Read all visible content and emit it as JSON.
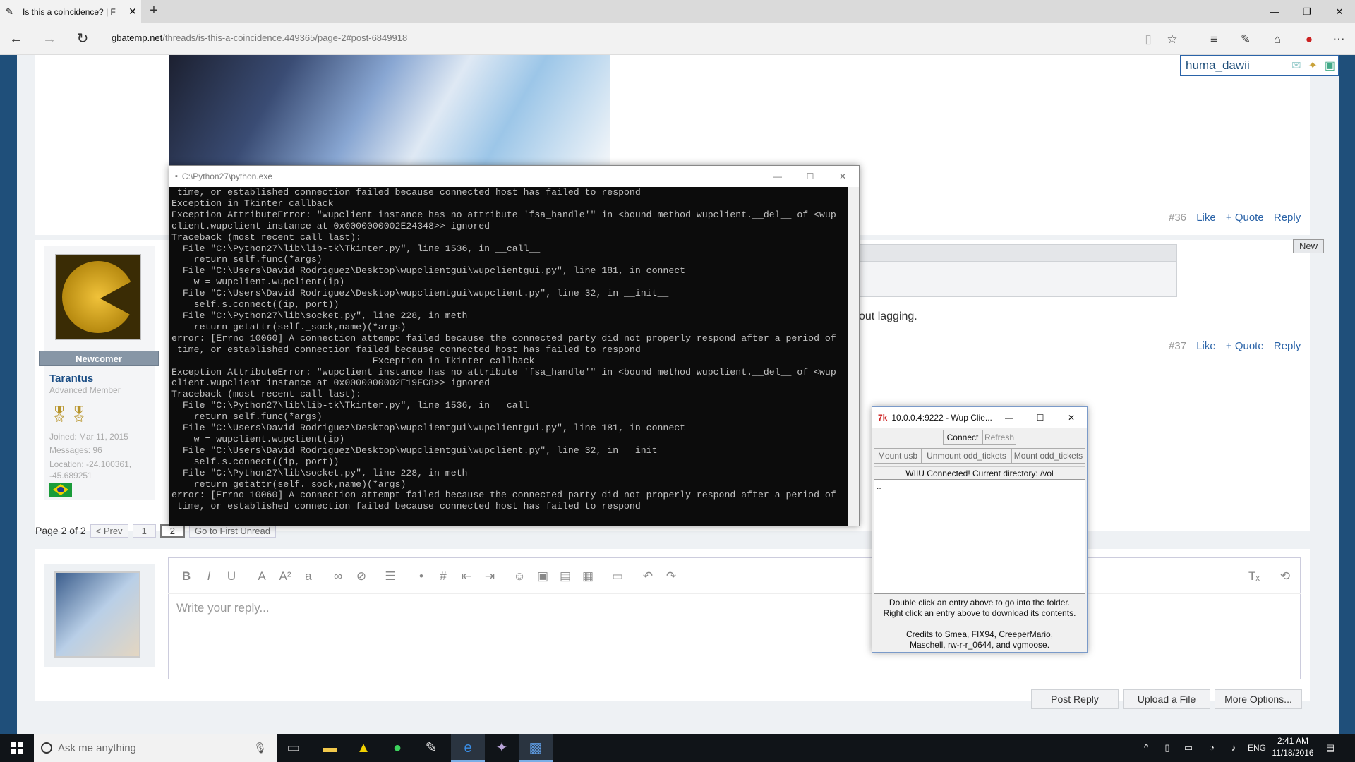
{
  "browser": {
    "tab_title": "Is this a coincidence? | F",
    "new_tab": "+",
    "url_domain": "gbatemp.net",
    "url_path": "/threads/is-this-a-coincidence.449365/page-2#post-6849918"
  },
  "header_user": {
    "name": "huma_dawii"
  },
  "posts": [
    {
      "number": "#36",
      "like": "Like",
      "quote": "+ Quote",
      "reply": "Reply"
    },
    {
      "number": "#37",
      "like": "Like",
      "quote": "+ Quote",
      "reply": "Reply",
      "text_fragment": "out lagging.",
      "new_badge": "New"
    }
  ],
  "author": {
    "rank": "Newcomer",
    "name": "Tarantus",
    "title": "Advanced Member",
    "joined": "Joined: Mar 11, 2015",
    "messages": "Messages: 96",
    "location1": "Location: -24.100361,",
    "location2": "-45.689251"
  },
  "pagination": {
    "label": "Page 2 of 2",
    "prev": "< Prev",
    "page1": "1",
    "page2": "2",
    "first_unread": "Go to First Unread"
  },
  "reply": {
    "placeholder": "Write your reply...",
    "post_reply": "Post Reply",
    "upload": "Upload a File",
    "more": "More Options..."
  },
  "console": {
    "title": "C:\\Python27\\python.exe",
    "output": " time, or established connection failed because connected host has failed to respond\nException in Tkinter callback\nException AttributeError: \"wupclient instance has no attribute 'fsa_handle'\" in <bound method wupclient.__del__ of <wup\nclient.wupclient instance at 0x0000000002E24348>> ignored\nTraceback (most recent call last):\n  File \"C:\\Python27\\lib\\lib-tk\\Tkinter.py\", line 1536, in __call__\n    return self.func(*args)\n  File \"C:\\Users\\David Rodriguez\\Desktop\\wupclientgui\\wupclientgui.py\", line 181, in connect\n    w = wupclient.wupclient(ip)\n  File \"C:\\Users\\David Rodriguez\\Desktop\\wupclientgui\\wupclient.py\", line 32, in __init__\n    self.s.connect((ip, port))\n  File \"C:\\Python27\\lib\\socket.py\", line 228, in meth\n    return getattr(self._sock,name)(*args)\nerror: [Errno 10060] A connection attempt failed because the connected party did not properly respond after a period of\n time, or established connection failed because connected host has failed to respond\n                                    Exception in Tkinter callback\nException AttributeError: \"wupclient instance has no attribute 'fsa_handle'\" in <bound method wupclient.__del__ of <wup\nclient.wupclient instance at 0x0000000002E19FC8>> ignored\nTraceback (most recent call last):\n  File \"C:\\Python27\\lib\\lib-tk\\Tkinter.py\", line 1536, in __call__\n    return self.func(*args)\n  File \"C:\\Users\\David Rodriguez\\Desktop\\wupclientgui\\wupclientgui.py\", line 181, in connect\n    w = wupclient.wupclient(ip)\n  File \"C:\\Users\\David Rodriguez\\Desktop\\wupclientgui\\wupclient.py\", line 32, in __init__\n    self.s.connect((ip, port))\n  File \"C:\\Python27\\lib\\socket.py\", line 228, in meth\n    return getattr(self._sock,name)(*args)\nerror: [Errno 10060] A connection attempt failed because the connected party did not properly respond after a period of\n time, or established connection failed because connected host has failed to respond"
  },
  "wup": {
    "title": "10.0.0.4:9222 - Wup Clie...",
    "connect": "Connect",
    "refresh": "Refresh",
    "mount_usb": "Mount usb",
    "unmount_odd": "Unmount odd_tickets",
    "mount_odd": "Mount odd_tickets",
    "status": "WIIU Connected! Current directory: /vol",
    "list_item": "..",
    "help1": "Double click an entry above to go into the folder.",
    "help2": "Right click an entry above to download its contents.",
    "credits1": "Credits to Smea, FIX94, CreeperMario,",
    "credits2": "Maschell, rw-r-r_0644, and vgmoose."
  },
  "taskbar": {
    "search": "Ask me anything",
    "lang": "ENG",
    "time": "2:41 AM",
    "date": "11/18/2016"
  },
  "colors": {
    "accent": "#2a63a8",
    "site_blue": "#1f4f7a",
    "console_bg": "#0c0c0c"
  }
}
